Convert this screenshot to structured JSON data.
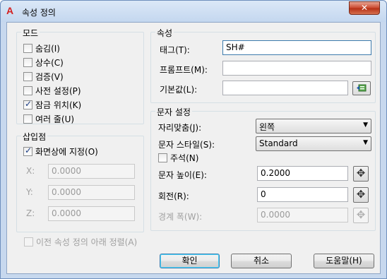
{
  "window": {
    "title": "속성 정의",
    "close_glyph": "✕"
  },
  "mode": {
    "legend": "모드",
    "options": [
      {
        "label": "숨김(I)",
        "checked": false
      },
      {
        "label": "상수(C)",
        "checked": false
      },
      {
        "label": "검증(V)",
        "checked": false
      },
      {
        "label": "사전 설정(P)",
        "checked": false
      },
      {
        "label": "잠금 위치(K)",
        "checked": true
      },
      {
        "label": "여러 줄(U)",
        "checked": false
      }
    ]
  },
  "insertion_point": {
    "legend": "삽입점",
    "specify_on_screen_label": "화면상에 지정(O)",
    "specify_on_screen_checked": true,
    "x_label": "X:",
    "x_value": "0.0000",
    "y_label": "Y:",
    "y_value": "0.0000",
    "z_label": "Z:",
    "z_value": "0.0000"
  },
  "attribute": {
    "legend": "속성",
    "tag_label": "태그(T):",
    "tag_value": "SH#",
    "prompt_label": "프롬프트(M):",
    "prompt_value": "",
    "default_label": "기본값(L):",
    "default_value": ""
  },
  "text_settings": {
    "legend": "문자 설정",
    "justification_label": "자리맞춤(J):",
    "justification_value": "왼쪽",
    "text_style_label": "문자 스타일(S):",
    "text_style_value": "Standard",
    "annotative_label": "주석(N)",
    "annotative_checked": false,
    "text_height_label": "문자 높이(E):",
    "text_height_value": "0.2000",
    "rotation_label": "회전(R):",
    "rotation_value": "0",
    "boundary_width_label": "경계 폭(W):",
    "boundary_width_value": "0.0000"
  },
  "align_below_label": "이전 속성 정의 아래 정렬(A)",
  "buttons": {
    "ok": "확인",
    "cancel": "취소",
    "help": "도움말(H)"
  },
  "icons": {
    "pick_point": "✥"
  }
}
